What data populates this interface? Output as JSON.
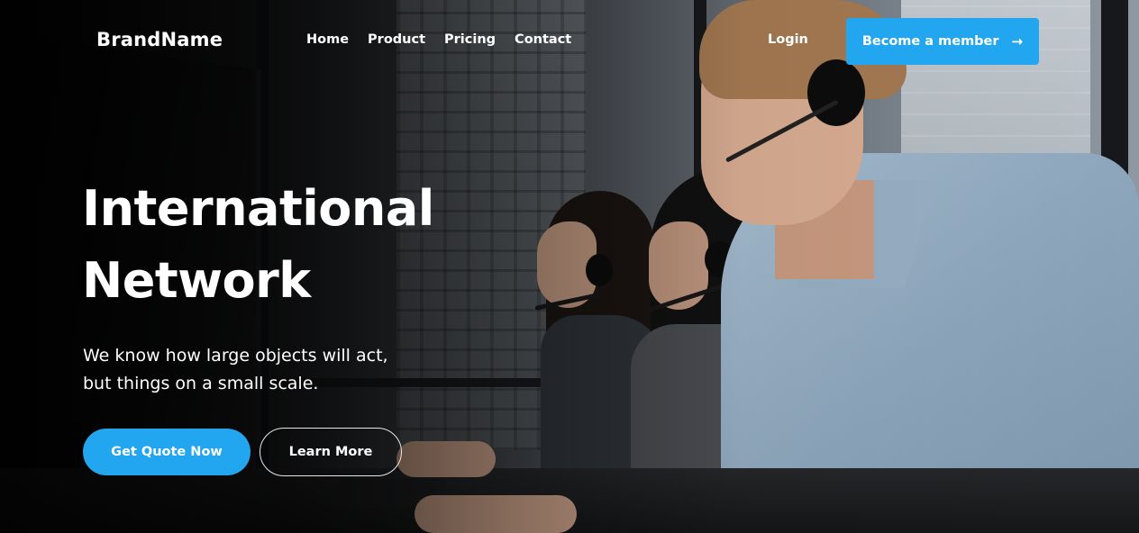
{
  "header": {
    "brand": "BrandName",
    "nav": [
      "Home",
      "Product",
      "Pricing",
      "Contact"
    ],
    "login": "Login",
    "member_button": "Become a member"
  },
  "hero": {
    "title_line1": "International",
    "title_line2": "Network",
    "subtitle_line1": "We know how large objects will act,",
    "subtitle_line2": "but things on a small scale.",
    "primary_button": "Get Quote Now",
    "secondary_button": "Learn More"
  },
  "colors": {
    "accent": "#23a6f0",
    "text": "#ffffff"
  },
  "icons": {
    "member_button_icon": "arrow-right-icon"
  }
}
